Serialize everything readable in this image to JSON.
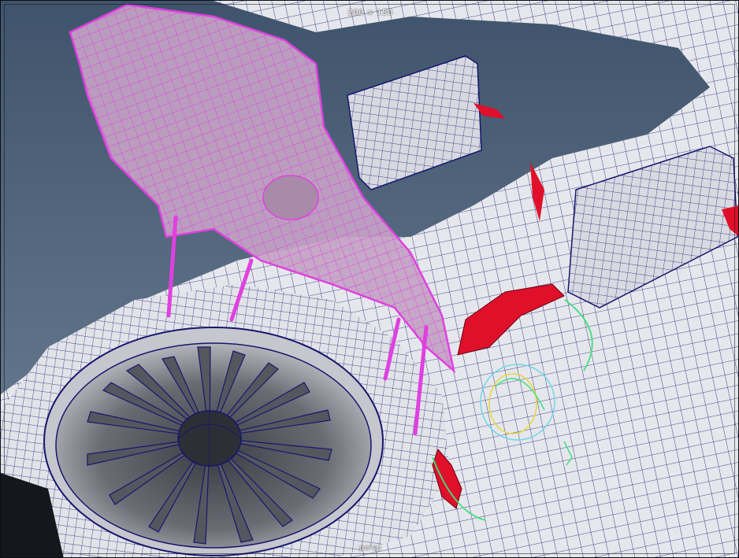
{
  "viewport": {
    "resolution_gate": "200 × 150",
    "camera": "persp"
  },
  "colors": {
    "background_sky": "#4a5e74",
    "wire_blue": "#16166e",
    "surface": "#e9eaee",
    "surface_shadow": "#b9bbc3",
    "selected_wire": "#e040e0",
    "selected_fill": "#c9a9c9",
    "red_panel": "#e0102a",
    "manipulator_green": "#40e080",
    "manipulator_yellow": "#e6d840",
    "manipulator_cyan": "#70d8e8"
  }
}
